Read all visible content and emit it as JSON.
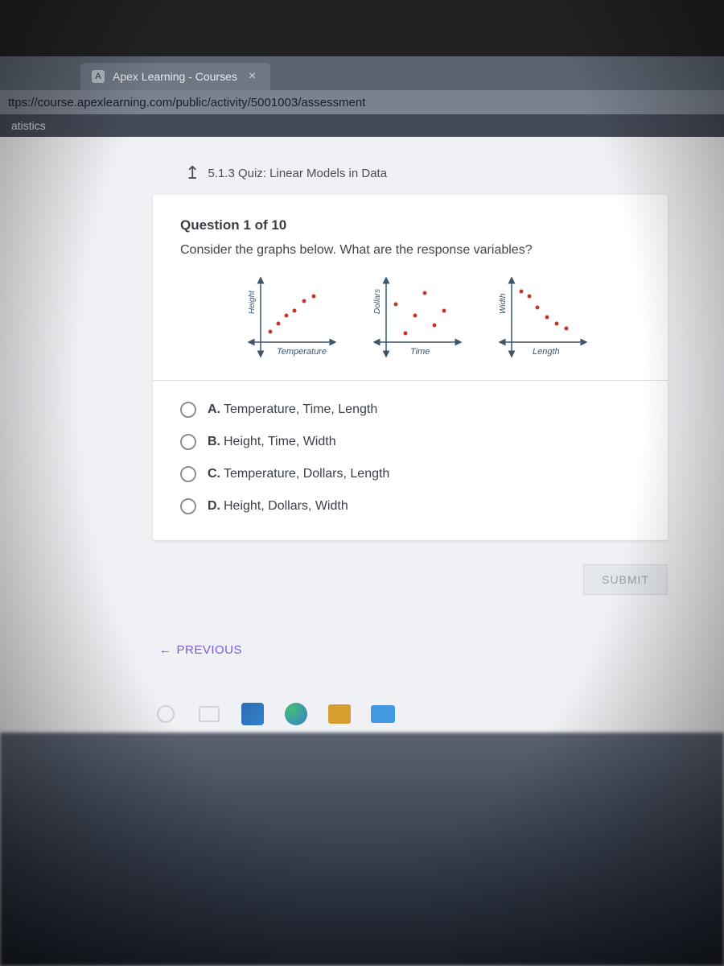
{
  "browser": {
    "tab_title": "Apex Learning - Courses",
    "url": "ttps://course.apexlearning.com/public/activity/5001003/assessment"
  },
  "app": {
    "course_label": "atistics",
    "quiz_label": "5.1.3 Quiz: Linear Models in Data"
  },
  "question": {
    "number_label": "Question 1 of 10",
    "prompt": "Consider the graphs below. What are the response variables?",
    "graphs": [
      {
        "y_label": "Height",
        "x_label": "Temperature"
      },
      {
        "y_label": "Dollars",
        "x_label": "Time"
      },
      {
        "y_label": "Width",
        "x_label": "Length"
      }
    ],
    "answers": [
      {
        "letter": "A.",
        "text": "Temperature, Time, Length"
      },
      {
        "letter": "B.",
        "text": "Height, Time, Width"
      },
      {
        "letter": "C.",
        "text": "Temperature, Dollars, Length"
      },
      {
        "letter": "D.",
        "text": "Height, Dollars, Width"
      }
    ]
  },
  "buttons": {
    "submit": "SUBMIT",
    "previous": "PREVIOUS"
  },
  "chart_data": [
    {
      "type": "scatter",
      "title": "",
      "xlabel": "Temperature",
      "ylabel": "Height",
      "trend": "positive",
      "points": [
        {
          "x": 1,
          "y": 1
        },
        {
          "x": 2,
          "y": 2
        },
        {
          "x": 3,
          "y": 3
        },
        {
          "x": 4,
          "y": 3.8
        },
        {
          "x": 5,
          "y": 5
        },
        {
          "x": 6,
          "y": 5.5
        }
      ],
      "xlim": [
        0,
        7
      ],
      "ylim": [
        0,
        7
      ]
    },
    {
      "type": "scatter",
      "title": "",
      "xlabel": "Time",
      "ylabel": "Dollars",
      "trend": "none",
      "points": [
        {
          "x": 1,
          "y": 4.5
        },
        {
          "x": 2,
          "y": 1.2
        },
        {
          "x": 3,
          "y": 3.2
        },
        {
          "x": 4,
          "y": 5.5
        },
        {
          "x": 5,
          "y": 2.2
        },
        {
          "x": 6,
          "y": 3.8
        }
      ],
      "xlim": [
        0,
        7
      ],
      "ylim": [
        0,
        7
      ]
    },
    {
      "type": "scatter",
      "title": "",
      "xlabel": "Length",
      "ylabel": "Width",
      "trend": "negative",
      "points": [
        {
          "x": 1,
          "y": 5.8
        },
        {
          "x": 2,
          "y": 5.2
        },
        {
          "x": 3,
          "y": 4.0
        },
        {
          "x": 4,
          "y": 3.0
        },
        {
          "x": 5,
          "y": 2.4
        },
        {
          "x": 6,
          "y": 1.9
        }
      ],
      "xlim": [
        0,
        7
      ],
      "ylim": [
        0,
        7
      ]
    }
  ]
}
